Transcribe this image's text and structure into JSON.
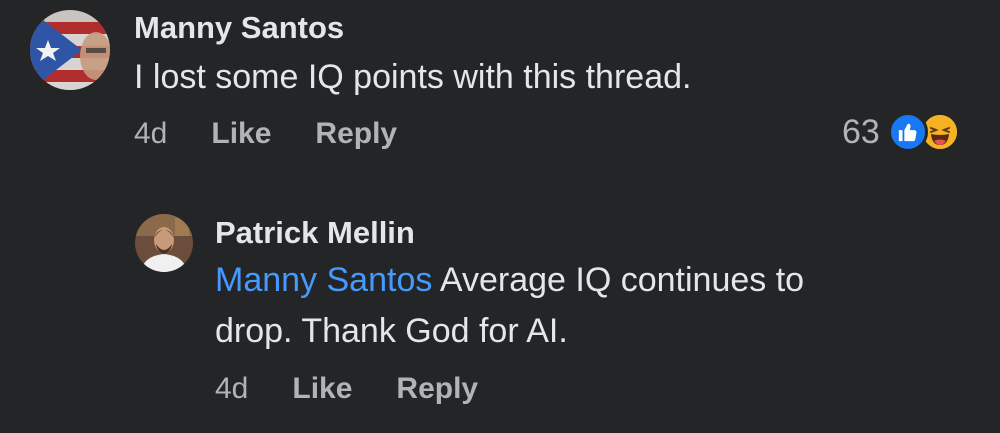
{
  "comment_1": {
    "author": "Manny Santos",
    "text": "I lost some IQ points with this thread.",
    "time": "4d",
    "like_label": "Like",
    "reply_label": "Reply",
    "reaction_count": "63",
    "reactions": [
      "like-icon",
      "haha-icon"
    ],
    "avatar_icon": "avatar-flag-icon"
  },
  "reply_1": {
    "author": "Patrick Mellin",
    "mention": "Manny Santos",
    "text_line1": " Average IQ continues to",
    "text_line2": "drop. Thank God for AI.",
    "time": "4d",
    "like_label": "Like",
    "reply_label": "Reply",
    "avatar_icon": "avatar-photo-icon"
  },
  "colors": {
    "background": "#242526",
    "text": "#e4e6eb",
    "secondary": "#b0b3b8",
    "mention": "#4599ff",
    "like_blue": "#1877f2",
    "haha_yellow": "#f7b125"
  }
}
